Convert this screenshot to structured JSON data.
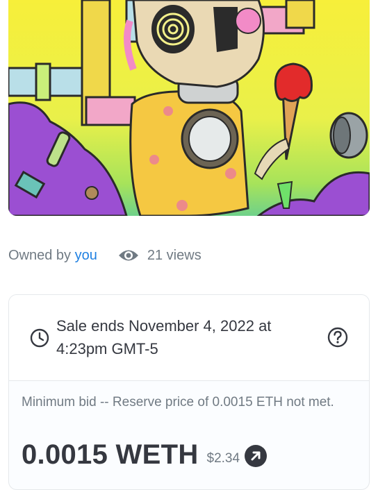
{
  "artwork": {
    "alt": "NFT artwork"
  },
  "ownership": {
    "owned_by_prefix": "Owned by",
    "owner": "you",
    "views": "21 views"
  },
  "sale": {
    "ends_text": "Sale ends November 4, 2022 at 4:23pm GMT-5"
  },
  "bid": {
    "minimum_text": "Minimum bid -- Reserve price of 0.0015 ETH not met.",
    "price": "0.0015 WETH",
    "usd": "$2.34"
  },
  "icons": {
    "views": "eye-icon",
    "sale": "clock-icon",
    "help": "question-circle-icon",
    "usd_link": "arrow-up-right-circle-icon"
  },
  "colors": {
    "link": "#2081e2",
    "text": "#353840",
    "secondary": "#707a83",
    "border": "#e5e8eb"
  }
}
